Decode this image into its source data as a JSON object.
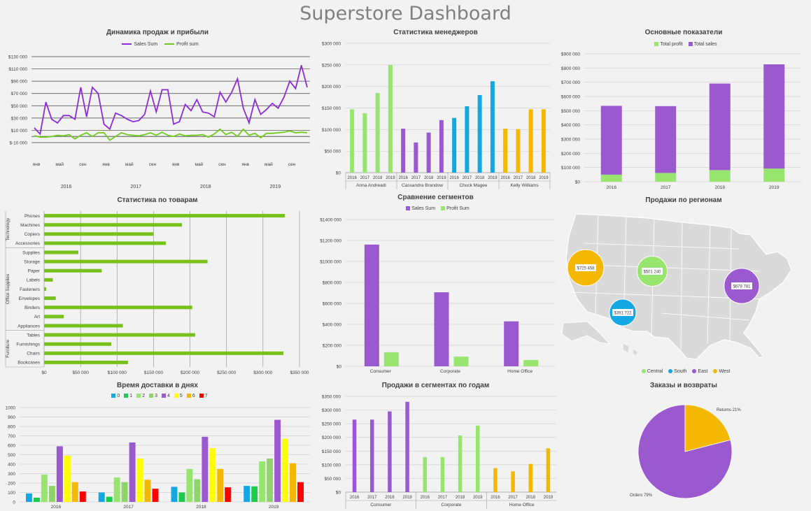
{
  "page": {
    "title": "Superstore Dashboard"
  },
  "colors": {
    "purple": "#9b59d0",
    "green": "#97e46e",
    "darkgreen": "#76c21b",
    "blue": "#13a8e3",
    "orange": "#f5b800",
    "salesLine": "#8b2bd9",
    "profitLine": "#6ecb1a",
    "red": "#ff0000",
    "yellow": "#ffff00",
    "grid": "#bfbfbf"
  },
  "chart_data": [
    {
      "id": "sales_profit",
      "type": "line",
      "title": "Динамика продаж и прибыли",
      "legend": [
        "Sales Sum",
        "Profit sum"
      ],
      "y_ticks": [
        "$130 000",
        "$110 000",
        "$90 000",
        "$70 000",
        "$50 000",
        "$30 000",
        "$10 000",
        "$-10 000"
      ],
      "ylim": [
        -10000,
        130000
      ],
      "month_labels": [
        "янв",
        "май",
        "сен",
        "янв",
        "май",
        "сен",
        "янв",
        "май",
        "сен",
        "янв",
        "май",
        "сен"
      ],
      "years": [
        "2016",
        "2017",
        "2018",
        "2019"
      ],
      "series": [
        {
          "name": "Sales Sum",
          "values": [
            14000,
            4000,
            56000,
            28000,
            22000,
            34000,
            34000,
            28000,
            80000,
            32000,
            80000,
            70000,
            20000,
            12000,
            38000,
            34000,
            28000,
            24000,
            26000,
            36000,
            74000,
            40000,
            76000,
            76000,
            20000,
            24000,
            52000,
            42000,
            60000,
            40000,
            38000,
            32000,
            72000,
            56000,
            72000,
            94000,
            46000,
            22000,
            60000,
            36000,
            44000,
            54000,
            46000,
            64000,
            90000,
            78000,
            116000,
            80000
          ]
        },
        {
          "name": "Profit sum",
          "values": [
            1000,
            -1000,
            -1000,
            0,
            2000,
            1000,
            3000,
            -4000,
            2000,
            6000,
            0,
            6000,
            6000,
            -6000,
            0,
            6000,
            3000,
            2000,
            1000,
            3000,
            6000,
            2000,
            7000,
            2000,
            0,
            4000,
            1000,
            2000,
            2000,
            3000,
            -1000,
            4000,
            12000,
            3000,
            7000,
            0,
            12000,
            2000,
            5000,
            -2000,
            5000,
            5000,
            6000,
            7000,
            9000,
            6000,
            7000,
            6000
          ]
        }
      ]
    },
    {
      "id": "managers",
      "type": "bar",
      "title": "Статистика менеджеров",
      "y_ticks": [
        "$300 000",
        "$250 000",
        "$200 000",
        "$150 000",
        "$100 000",
        "$50 000",
        "$0"
      ],
      "ylim": [
        0,
        300000
      ],
      "groups": [
        {
          "name": "Anna Andreadi",
          "color": "green",
          "years": [
            "2016",
            "2017",
            "2018",
            "2019"
          ],
          "values": [
            147000,
            138000,
            185000,
            250000
          ]
        },
        {
          "name": "Cassandra Brandow",
          "color": "purple",
          "years": [
            "2016",
            "2017",
            "2018",
            "2019"
          ],
          "values": [
            102000,
            70000,
            93000,
            122000
          ]
        },
        {
          "name": "Chuck Magee",
          "color": "blue",
          "years": [
            "2016",
            "2017",
            "2018",
            "2019"
          ],
          "values": [
            127000,
            154000,
            180000,
            212000
          ]
        },
        {
          "name": "Kelly Williams",
          "color": "orange",
          "years": [
            "2016",
            "2017",
            "2018",
            "2019"
          ],
          "values": [
            102000,
            101000,
            147000,
            147000
          ]
        }
      ]
    },
    {
      "id": "main_indicators",
      "type": "bar",
      "stacked": true,
      "title": "Основные показатели",
      "legend": [
        "Total profit",
        "Total sales"
      ],
      "y_ticks": [
        "$900 000",
        "$800 000",
        "$700 000",
        "$600 000",
        "$500 000",
        "$400 000",
        "$300 000",
        "$200 000",
        "$100 000",
        "$0"
      ],
      "ylim": [
        0,
        900000
      ],
      "categories": [
        "2016",
        "2017",
        "2018",
        "2019"
      ],
      "series": [
        {
          "name": "Total profit",
          "values": [
            50000,
            62000,
            82000,
            93000
          ]
        },
        {
          "name": "Total sales",
          "values": [
            484000,
            470000,
            609000,
            733000
          ]
        }
      ]
    },
    {
      "id": "products",
      "type": "bar",
      "orientation": "horizontal",
      "title": "Статистика по товарам",
      "x_ticks": [
        "$0",
        "$50 000",
        "$100 000",
        "$150 000",
        "$200 000",
        "$250 000",
        "$300 000",
        "$350 000"
      ],
      "xlim": [
        0,
        350000
      ],
      "groups": [
        {
          "name": "Technology",
          "items": [
            {
              "label": "Phones",
              "value": 330000
            },
            {
              "label": "Machines",
              "value": 189000
            },
            {
              "label": "Copiers",
              "value": 150000
            },
            {
              "label": "Accessories",
              "value": 167000
            }
          ]
        },
        {
          "name": "Office Supplies",
          "items": [
            {
              "label": "Supplies",
              "value": 47000
            },
            {
              "label": "Storage",
              "value": 224000
            },
            {
              "label": "Paper",
              "value": 79000
            },
            {
              "label": "Labels",
              "value": 12000
            },
            {
              "label": "Fasteners",
              "value": 3000
            },
            {
              "label": "Envelopes",
              "value": 16000
            },
            {
              "label": "Binders",
              "value": 203000
            },
            {
              "label": "Art",
              "value": 27000
            },
            {
              "label": "Appliances",
              "value": 108000
            }
          ]
        },
        {
          "name": "Furniture",
          "items": [
            {
              "label": "Tables",
              "value": 207000
            },
            {
              "label": "Furnishings",
              "value": 92000
            },
            {
              "label": "Chairs",
              "value": 328000
            },
            {
              "label": "Bookcases",
              "value": 115000
            }
          ]
        }
      ]
    },
    {
      "id": "segments",
      "type": "bar",
      "title": "Сравнение сегментов",
      "legend": [
        "Sales Sum",
        "Profit Sum"
      ],
      "y_ticks": [
        "$1400 000",
        "$1200 000",
        "$1000 000",
        "$800 000",
        "$600 000",
        "$400 000",
        "$200 000",
        "$0"
      ],
      "ylim": [
        0,
        1400000
      ],
      "categories": [
        "Consumer",
        "Corporate",
        "Home Office"
      ],
      "series": [
        {
          "name": "Sales Sum",
          "values": [
            1161000,
            706000,
            429000
          ]
        },
        {
          "name": "Profit Sum",
          "values": [
            134000,
            92000,
            60000
          ]
        }
      ]
    },
    {
      "id": "regions",
      "type": "bubble-map",
      "title": "Продажи по регионам",
      "legend": [
        "Central",
        "South",
        "East",
        "West"
      ],
      "bubbles": [
        {
          "region": "West",
          "label": "$725 458",
          "value": 725458,
          "color": "orange"
        },
        {
          "region": "Central",
          "label": "$501 240",
          "value": 501240,
          "color": "green"
        },
        {
          "region": "East",
          "label": "$678 781",
          "value": 678781,
          "color": "purple"
        },
        {
          "region": "South",
          "label": "$391 722",
          "value": 391722,
          "color": "blue"
        }
      ]
    },
    {
      "id": "delivery",
      "type": "bar",
      "title": "Время доставки в днях",
      "legend": [
        "0",
        "1",
        "2",
        "3",
        "4",
        "5",
        "6",
        "7"
      ],
      "series_colors": [
        "#13a8e3",
        "#1ccb4e",
        "#97e46e",
        "#8fd46a",
        "#9b59d0",
        "#ffff00",
        "#f5b800",
        "#ff0000"
      ],
      "y_ticks": [
        "1000",
        "900",
        "800",
        "700",
        "600",
        "500",
        "400",
        "300",
        "200",
        "100",
        "0"
      ],
      "ylim": [
        0,
        1000
      ],
      "categories": [
        "2016",
        "2017",
        "2018",
        "2019"
      ],
      "values": [
        [
          90,
          45,
          290,
          170,
          590,
          490,
          210,
          110
        ],
        [
          100,
          55,
          260,
          210,
          630,
          460,
          235,
          140
        ],
        [
          160,
          100,
          350,
          240,
          690,
          570,
          350,
          155
        ],
        [
          170,
          165,
          430,
          460,
          870,
          670,
          410,
          210
        ]
      ]
    },
    {
      "id": "segments_years",
      "type": "bar",
      "title": "Продажи в сегментах по годам",
      "y_ticks": [
        "$350 000",
        "$300 000",
        "$250 000",
        "$200 000",
        "$150 000",
        "$100 000",
        "$50 000",
        "$0"
      ],
      "ylim": [
        0,
        350000
      ],
      "groups": [
        {
          "name": "Consumer",
          "color": "purple",
          "years": [
            "2016",
            "2017",
            "2018",
            "2019"
          ],
          "values": [
            265000,
            265000,
            295000,
            330000
          ]
        },
        {
          "name": "Corporate",
          "color": "green",
          "years": [
            "2016",
            "2017",
            "2018",
            "2019"
          ],
          "values": [
            128000,
            128000,
            207000,
            243000
          ]
        },
        {
          "name": "Home Office",
          "color": "orange",
          "years": [
            "2016",
            "2017",
            "2018",
            "2019"
          ],
          "values": [
            88000,
            76000,
            103000,
            160000
          ]
        }
      ]
    },
    {
      "id": "orders_returns",
      "type": "pie",
      "title": "Заказы и возвраты",
      "slices": [
        {
          "label": "Orders 79%",
          "value": 79,
          "color": "purple"
        },
        {
          "label": "Returns 21%",
          "value": 21,
          "color": "orange"
        }
      ]
    }
  ]
}
